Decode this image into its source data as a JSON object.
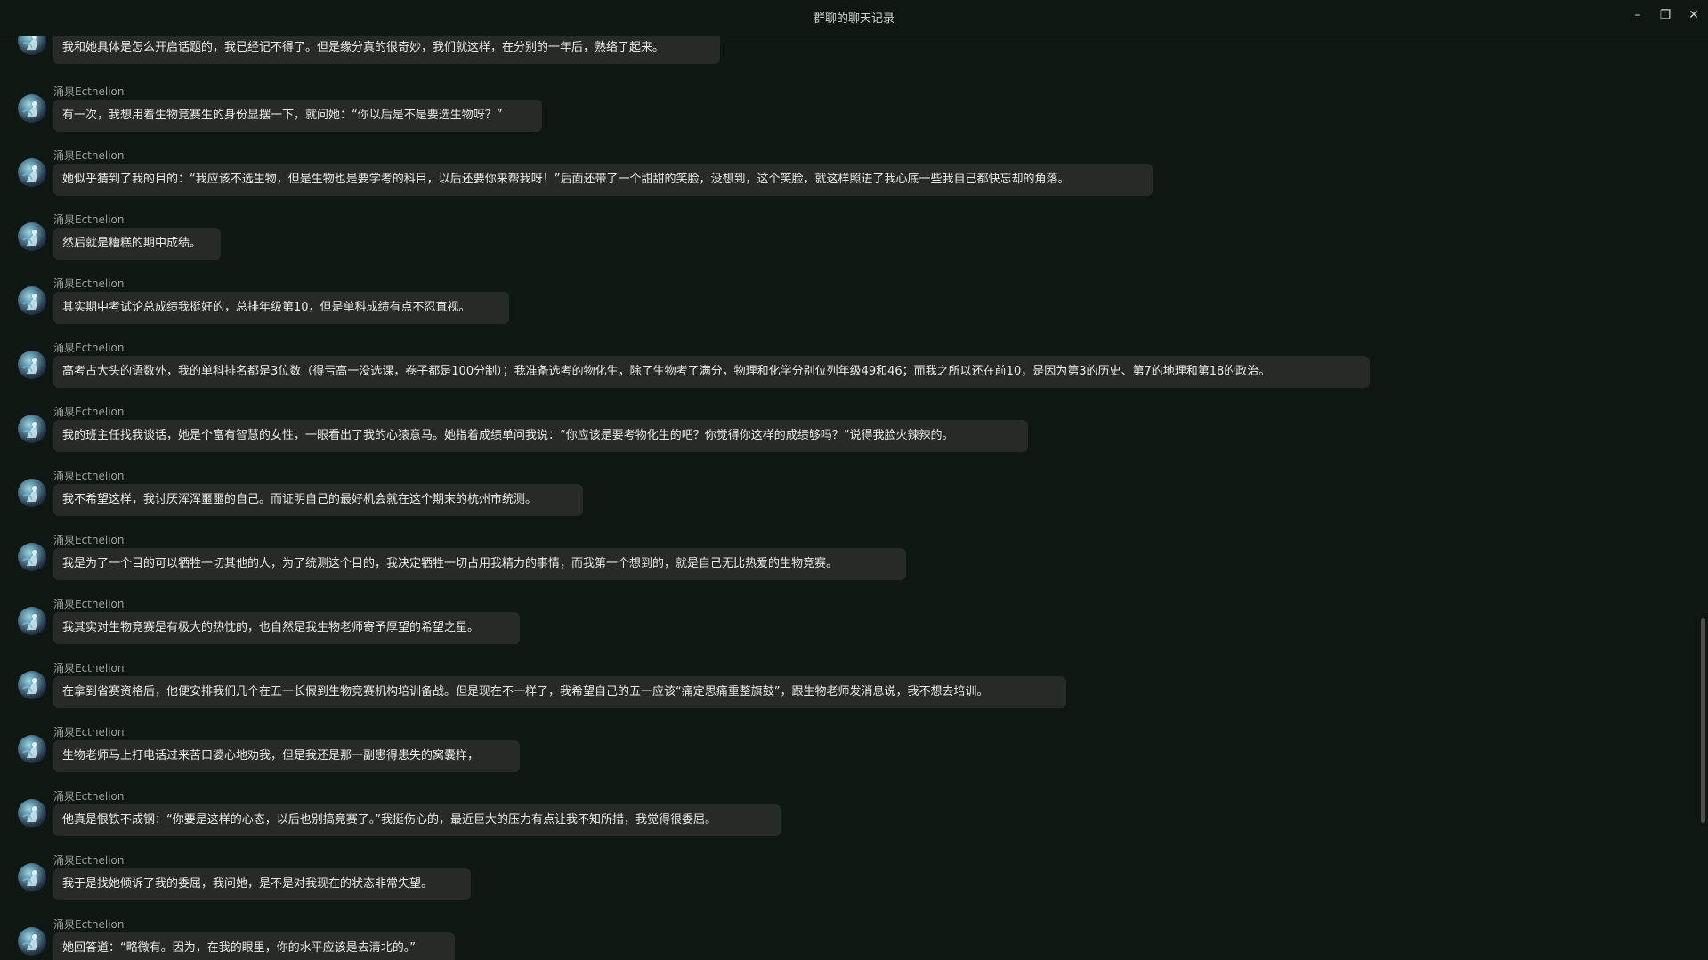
{
  "window": {
    "title": "群聊的聊天记录",
    "minimize_glyph": "–",
    "restore_glyph": "❐",
    "close_glyph": "✕"
  },
  "messages": [
    {
      "sender": "",
      "text": "我和她具体是怎么开启话题的，我已经记不得了。但是缘分真的很奇妙，我们就这样，在分别的一年后，熟络了起来。"
    },
    {
      "sender": "涌泉Ecthelion",
      "text": "有一次，我想用着生物竞赛生的身份显摆一下，就问她：“你以后是不是要选生物呀？”"
    },
    {
      "sender": "涌泉Ecthelion",
      "text": "她似乎猜到了我的目的：“我应该不选生物，但是生物也是要学考的科目，以后还要你来帮我呀！”后面还带了一个甜甜的笑脸，没想到，这个笑脸，就这样照进了我心底一些我自己都快忘却的角落。"
    },
    {
      "sender": "涌泉Ecthelion",
      "text": "然后就是糟糕的期中成绩。"
    },
    {
      "sender": "涌泉Ecthelion",
      "text": "其实期中考试论总成绩我挺好的，总排年级第10，但是单科成绩有点不忍直视。"
    },
    {
      "sender": "涌泉Ecthelion",
      "text": "高考占大头的语数外，我的单科排名都是3位数（得亏高一没选课，卷子都是100分制）；我准备选考的物化生，除了生物考了满分，物理和化学分别位列年级49和46；而我之所以还在前10，是因为第3的历史、第7的地理和第18的政治。"
    },
    {
      "sender": "涌泉Ecthelion",
      "text": "我的班主任找我谈话，她是个富有智慧的女性，一眼看出了我的心猿意马。她指着成绩单问我说：“你应该是要考物化生的吧？你觉得你这样的成绩够吗？”说得我脸火辣辣的。"
    },
    {
      "sender": "涌泉Ecthelion",
      "text": "我不希望这样，我讨厌浑浑噩噩的自己。而证明自己的最好机会就在这个期末的杭州市统测。"
    },
    {
      "sender": "涌泉Ecthelion",
      "text": "我是为了一个目的可以牺牲一切其他的人，为了统测这个目的，我决定牺牲一切占用我精力的事情，而我第一个想到的，就是自己无比热爱的生物竞赛。"
    },
    {
      "sender": "涌泉Ecthelion",
      "text": "我其实对生物竞赛是有极大的热忱的，也自然是我生物老师寄予厚望的希望之星。"
    },
    {
      "sender": "涌泉Ecthelion",
      "text": "在拿到省赛资格后，他便安排我们几个在五一长假到生物竞赛机构培训备战。但是现在不一样了，我希望自己的五一应该“痛定思痛重整旗鼓”，跟生物老师发消息说，我不想去培训。"
    },
    {
      "sender": "涌泉Ecthelion",
      "text": "生物老师马上打电话过来苦口婆心地劝我，但是我还是那一副患得患失的窝囊样，"
    },
    {
      "sender": "涌泉Ecthelion",
      "text": "他真是恨铁不成钢：“你要是这样的心态，以后也别搞竞赛了。”我挺伤心的，最近巨大的压力有点让我不知所措，我觉得很委屈。"
    },
    {
      "sender": "涌泉Ecthelion",
      "text": "我于是找她倾诉了我的委屈，我问她，是不是对我现在的状态非常失望。"
    },
    {
      "sender": "涌泉Ecthelion",
      "text": "她回答道：“略微有。因为，在我的眼里，你的水平应该是去清北的。”"
    }
  ]
}
